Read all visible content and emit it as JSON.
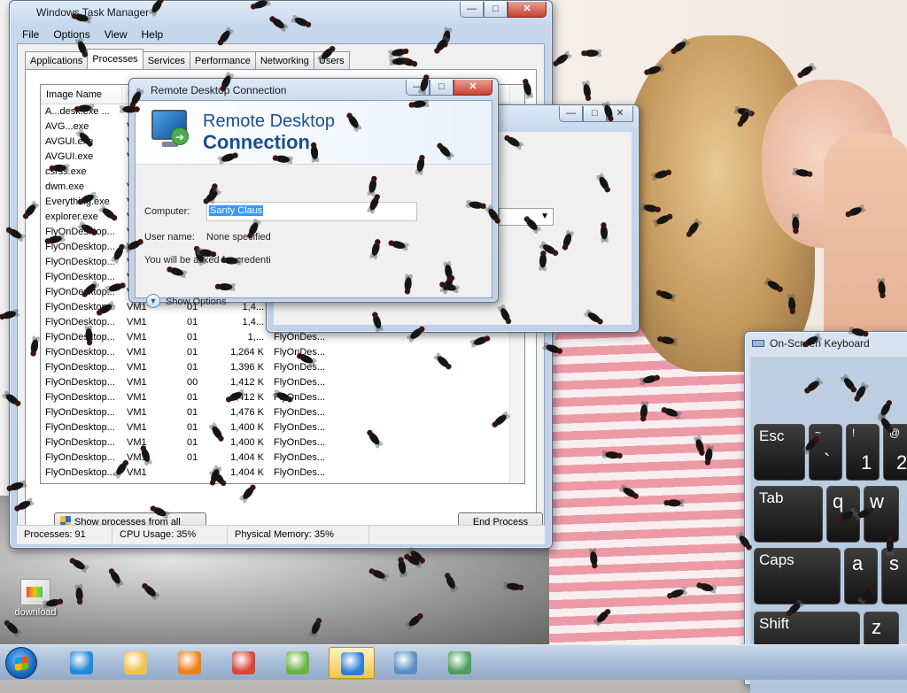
{
  "task_manager": {
    "title": "Windows Task Manager",
    "menu": [
      "File",
      "Options",
      "View",
      "Help"
    ],
    "tabs": [
      "Applications",
      "Processes",
      "Services",
      "Performance",
      "Networking",
      "Users"
    ],
    "active_tab": "Processes",
    "columns": {
      "image_name": "Image Name",
      "user": "U"
    },
    "rows": [
      {
        "name": "A...desk.exe ...",
        "user": "",
        "cpu": "",
        "mem": "",
        "desc": ""
      },
      {
        "name": "AVG...exe",
        "user": "V",
        "cpu": "",
        "mem": "",
        "desc": ""
      },
      {
        "name": "AVGUI.exe",
        "user": "V",
        "cpu": "",
        "mem": "",
        "desc": ""
      },
      {
        "name": "AVGUI.exe",
        "user": "V",
        "cpu": "",
        "mem": "",
        "desc": ""
      },
      {
        "name": "csrss.exe",
        "user": "",
        "cpu": "",
        "mem": "",
        "desc": ""
      },
      {
        "name": "dwm.exe",
        "user": "V",
        "cpu": "",
        "mem": "",
        "desc": ""
      },
      {
        "name": "Everything.exe",
        "user": "V",
        "cpu": "",
        "mem": "",
        "desc": ""
      },
      {
        "name": "explorer.exe",
        "user": "V",
        "cpu": "",
        "mem": "",
        "desc": ""
      },
      {
        "name": "FlyOnDesktop...",
        "user": "V",
        "cpu": "",
        "mem": "",
        "desc": ""
      },
      {
        "name": "FlyOnDesktop...",
        "user": "V",
        "cpu": "",
        "mem": "",
        "desc": ""
      },
      {
        "name": "FlyOnDesktop...",
        "user": "V",
        "cpu": "",
        "mem": "",
        "desc": ""
      },
      {
        "name": "FlyOnDesktop...",
        "user": "V",
        "cpu": "",
        "mem": "",
        "desc": ""
      },
      {
        "name": "FlyOnDesktop...",
        "user": "V",
        "cpu": "",
        "mem": "",
        "desc": ""
      },
      {
        "name": "FlyOnDesktop...",
        "user": "VM1",
        "cpu": "01",
        "mem": "1,4...",
        "desc": ""
      },
      {
        "name": "FlyOnDesktop...",
        "user": "VM1",
        "cpu": "01",
        "mem": "1,4...",
        "desc": ""
      },
      {
        "name": "FlyOnDesktop...",
        "user": "VM1",
        "cpu": "01",
        "mem": "1,...",
        "desc": "FlyOnDes..."
      },
      {
        "name": "FlyOnDesktop...",
        "user": "VM1",
        "cpu": "01",
        "mem": "1,264 K",
        "desc": "FlyOnDes..."
      },
      {
        "name": "FlyOnDesktop...",
        "user": "VM1",
        "cpu": "01",
        "mem": "1,396 K",
        "desc": "FlyOnDes..."
      },
      {
        "name": "FlyOnDesktop...",
        "user": "VM1",
        "cpu": "00",
        "mem": "1,412 K",
        "desc": "FlyOnDes..."
      },
      {
        "name": "FlyOnDesktop...",
        "user": "VM1",
        "cpu": "01",
        "mem": "1,412 K",
        "desc": "FlyOnDes..."
      },
      {
        "name": "FlyOnDesktop...",
        "user": "VM1",
        "cpu": "01",
        "mem": "1,476 K",
        "desc": "FlyOnDes..."
      },
      {
        "name": "FlyOnDesktop...",
        "user": "VM1",
        "cpu": "01",
        "mem": "1,400 K",
        "desc": "FlyOnDes..."
      },
      {
        "name": "FlyOnDesktop...",
        "user": "VM1",
        "cpu": "01",
        "mem": "1,400 K",
        "desc": "FlyOnDes..."
      },
      {
        "name": "FlyOnDesktop...",
        "user": "VM1",
        "cpu": "01",
        "mem": "1,404 K",
        "desc": "FlyOnDes..."
      },
      {
        "name": "FlyOnDesktop...",
        "user": "VM1",
        "cpu": "",
        "mem": "1,404 K",
        "desc": "FlyOnDes..."
      }
    ],
    "show_all_label": "Show processes from all users",
    "end_process_label": "End Process",
    "status": {
      "processes": "Processes: 91",
      "cpu": "CPU Usage: 35%",
      "memory": "Physical Memory: 35%"
    }
  },
  "rdc": {
    "title": "Remote Desktop Connection",
    "banner_line1": "Remote Desktop",
    "banner_line2": "Connection",
    "computer_label": "Computer:",
    "computer_value": "Santy Claus",
    "username_label": "User name:",
    "username_value": "None specified",
    "info_text": "You will be asked for credenti",
    "show_options_label": "Show Options"
  },
  "osk": {
    "title": "On-Screen Keyboard",
    "keys": {
      "esc": "Esc",
      "tilde_top": "~",
      "tilde_bottom": "`",
      "excl_top": "!",
      "one": "1",
      "at_top": "@",
      "two": "2",
      "tab": "Tab",
      "q": "q",
      "w": "w",
      "caps": "Caps",
      "a": "a",
      "s": "s",
      "shift": "Shift",
      "z": "z"
    }
  },
  "desktop_icon": {
    "label": "download"
  },
  "taskbar_items": [
    {
      "icon": "internet-explorer-icon",
      "color": "#1f8ad6"
    },
    {
      "icon": "windows-explorer-icon",
      "color": "#f0c14b"
    },
    {
      "icon": "media-player-icon",
      "color": "#ef7f1a"
    },
    {
      "icon": "chrome-icon",
      "color": "#db4437"
    },
    {
      "icon": "utorrent-icon",
      "color": "#6ab43e"
    },
    {
      "icon": "remote-desktop-icon",
      "color": "#2b7fd6",
      "active": true
    },
    {
      "icon": "network-computer-icon",
      "color": "#5a8fc4"
    },
    {
      "icon": "task-manager-icon",
      "color": "#4f9d5d"
    }
  ]
}
